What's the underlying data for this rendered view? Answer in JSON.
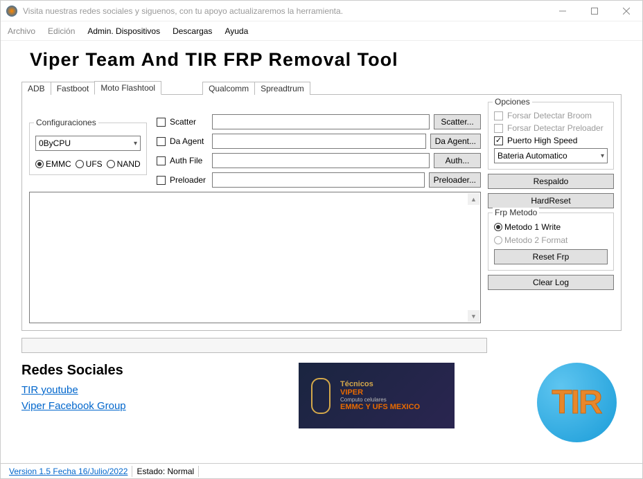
{
  "titlebar": {
    "title": "Visita nuestras redes sociales y siguenos, con tu apoyo actualizaremos la herramienta."
  },
  "menu": {
    "archivo": "Archivo",
    "edicion": "Edición",
    "admin": "Admin. Dispositivos",
    "descargas": "Descargas",
    "ayuda": "Ayuda"
  },
  "heading": "Viper Team And TIR FRP Removal Tool",
  "tabs": {
    "adb": "ADB",
    "fastboot": "Fastboot",
    "moto": "Moto Flashtool",
    "qualcomm": "Qualcomm",
    "spreadtrum": "Spreadtrum"
  },
  "config": {
    "legend": "Configuraciones",
    "dropdown_value": "0ByCPU",
    "emmc": "EMMC",
    "ufs": "UFS",
    "nand": "NAND"
  },
  "files": {
    "scatter_label": "Scatter",
    "scatter_btn": "Scatter...",
    "da_label": "Da Agent",
    "da_btn": "Da Agent...",
    "auth_label": "Auth File",
    "auth_btn": "Auth...",
    "preloader_label": "Preloader",
    "preloader_btn": "Preloader..."
  },
  "opciones": {
    "legend": "Opciones",
    "broom": "Forsar Detectar Broom",
    "preloader": "Forsar Detectar Preloader",
    "highspeed": "Puerto High Speed",
    "battery": "Bateria Automatico"
  },
  "actions": {
    "respaldo": "Respaldo",
    "hardreset": "HardReset",
    "frp_legend": "Frp Metodo",
    "metodo1": "Metodo 1 Write",
    "metodo2": "Metodo 2 Format",
    "reset_frp": "Reset Frp",
    "clear_log": "Clear Log"
  },
  "social": {
    "heading": "Redes Sociales",
    "link1": "TIR youtube",
    "link2": "Viper Facebook Group",
    "banner_t1": "Técnicos",
    "banner_t2": "VIPER",
    "banner_t3": "Computo celulares",
    "banner_t4": "EMMC Y UFS MEXICO",
    "logo_text": "TIR"
  },
  "statusbar": {
    "version": "Version 1.5 Fecha 16/Julio/2022",
    "estado": "Estado: Normal"
  }
}
